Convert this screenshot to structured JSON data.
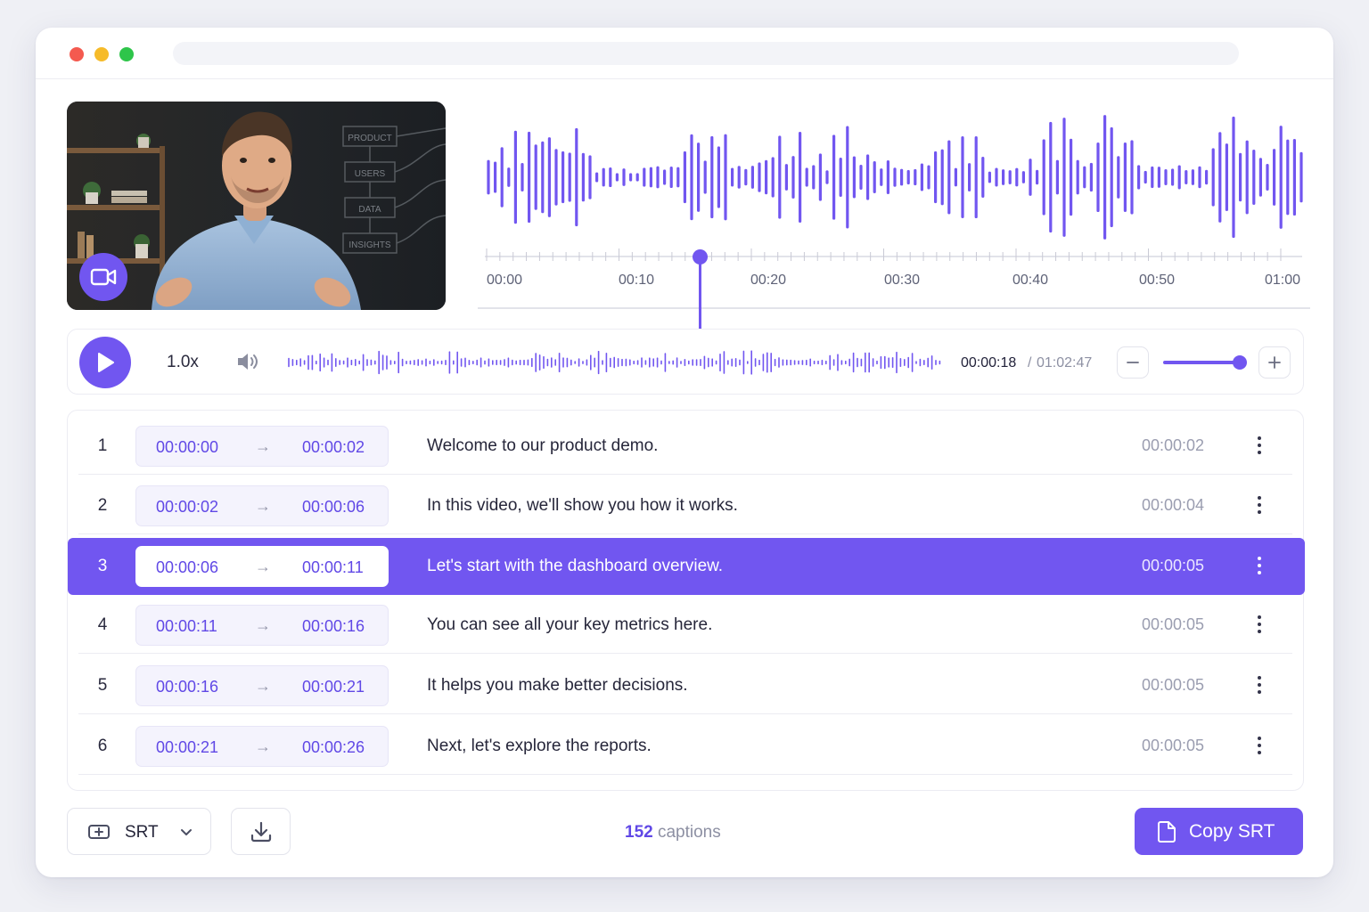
{
  "colors": {
    "accent": "#7156f0",
    "accent_text": "#6048e6",
    "muted": "#9a9db0"
  },
  "timeline": {
    "ticks": [
      "00:00",
      "00:10",
      "00:20",
      "00:30",
      "00:40",
      "00:50",
      "01:00"
    ]
  },
  "player": {
    "speed": "1.0x",
    "current_time": "00:00:18",
    "separator": "/",
    "total_time": "01:02:47",
    "zoom_level": 0.9,
    "playhead_fraction": 0.29
  },
  "captions": [
    {
      "index": "1",
      "start": "00:00:00",
      "arrow": "→",
      "end": "00:00:02",
      "text": "Welcome to our product demo.",
      "duration": "00:00:02"
    },
    {
      "index": "2",
      "start": "00:00:02",
      "arrow": "→",
      "end": "00:00:06",
      "text": "In this video, we'll show you how it works.",
      "duration": "00:00:04"
    },
    {
      "index": "3",
      "start": "00:00:06",
      "arrow": "→",
      "end": "00:00:11",
      "text": "Let's start with the dashboard overview.",
      "duration": "00:00:05",
      "active": true
    },
    {
      "index": "4",
      "start": "00:00:11",
      "arrow": "→",
      "end": "00:00:16",
      "text": "You can see all your key metrics here.",
      "duration": "00:00:05"
    },
    {
      "index": "5",
      "start": "00:00:16",
      "arrow": "→",
      "end": "00:00:21",
      "text": "It helps you make better decisions.",
      "duration": "00:00:05"
    },
    {
      "index": "6",
      "start": "00:00:21",
      "arrow": "→",
      "end": "00:00:26",
      "text": "Next, let's explore the reports.",
      "duration": "00:00:05"
    }
  ],
  "video": {
    "board_labels": [
      "PRODUCT",
      "USERS",
      "DATA",
      "INSIGHTS"
    ],
    "icon": "video-camera-icon"
  },
  "footer": {
    "format_label": "SRT",
    "caption_count": "152",
    "caption_count_suffix": "captions",
    "copy_label": "Copy SRT"
  },
  "icons": {
    "play": "play-icon",
    "volume": "volume-icon",
    "zoom_out": "minus-icon",
    "zoom_in": "plus-icon",
    "format": "caption-format-icon",
    "chevron": "chevron-down-icon",
    "download": "download-icon",
    "copy": "document-icon",
    "more": "more-vertical-icon"
  }
}
